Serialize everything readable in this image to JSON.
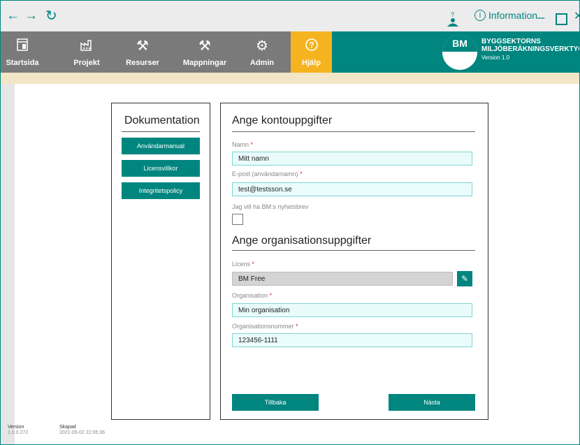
{
  "titlebar": {
    "back_icon": "arrow-left-icon",
    "forward_icon": "arrow-right-icon",
    "reload_icon": "reload-icon",
    "info_label": "Information"
  },
  "toolbar": {
    "items": [
      {
        "label": "Startsida",
        "icon": "home-icon"
      },
      {
        "label": "Projekt",
        "icon": "factory-icon"
      },
      {
        "label": "Resurser",
        "icon": "tools-icon"
      },
      {
        "label": "Mappningar",
        "icon": "tools-icon"
      },
      {
        "label": "Admin",
        "icon": "gear-icon"
      },
      {
        "label": "Hjälp",
        "icon": "help-icon"
      }
    ],
    "active": "Hjälp"
  },
  "brand": {
    "logo_text": "BM",
    "line1": "BYGGSEKTORNS",
    "line2": "MILJÖBERÄKNINGSVERKTYG",
    "version": "Version 1.0"
  },
  "docs": {
    "title": "Dokumentation",
    "buttons": [
      "Användarmanual",
      "Licensvillkor",
      "Integritetspolicy"
    ]
  },
  "form": {
    "account_heading": "Ange kontouppgifter",
    "name_label": "Namn",
    "name_value": "Mitt namn",
    "email_label": "E-post (användarnamn)",
    "email_value": "test@testsson.se",
    "newsletter_label": "Jag vill ha BM:s nyhetsbrev",
    "org_heading": "Ange organisationsuppgifter",
    "license_label": "Licens",
    "license_value": "BM Free",
    "org_label": "Organisation",
    "org_value": "Min  organisation",
    "orgnr_label": "Organisationsnummer",
    "orgnr_value": "123456-1111",
    "required_mark": "*",
    "back_button": "Tillbaka",
    "next_button": "Nästa"
  },
  "footer": {
    "version_label": "Version",
    "version_value": "1.0.0.272",
    "created_label": "Skapad",
    "created_value": "2021-05-02 22:05:36"
  },
  "colors": {
    "accent": "#00857f",
    "active_tab": "#f5b41f",
    "toolbar_gray": "#7a7a7a"
  }
}
